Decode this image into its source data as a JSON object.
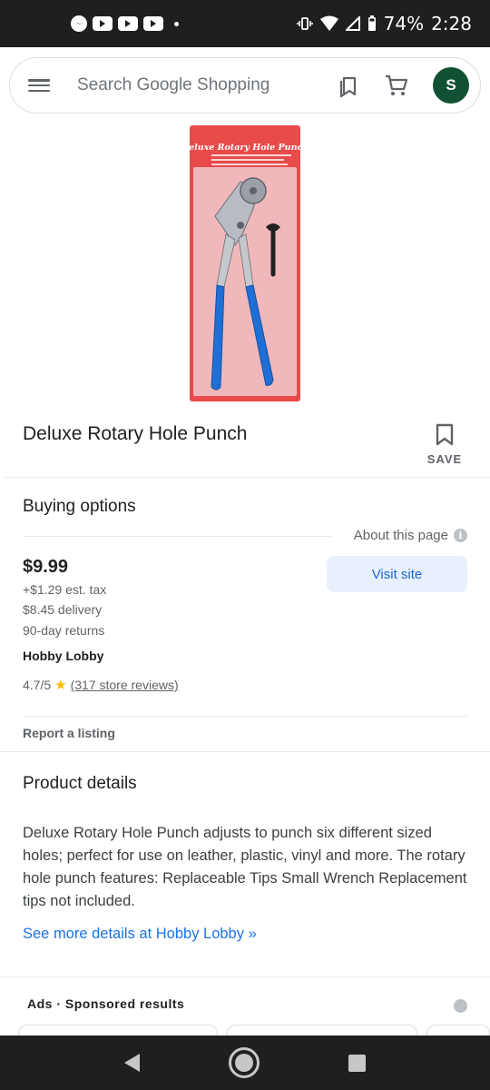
{
  "status_bar": {
    "battery": "74%",
    "time": "2:28"
  },
  "search": {
    "placeholder": "Search Google Shopping",
    "avatar_initial": "S"
  },
  "product": {
    "title": "Deluxe Rotary Hole Punch",
    "save_label": "SAVE",
    "package_text": "Deluxe Rotary Hole Punch"
  },
  "buying_options": {
    "heading": "Buying options",
    "about_page": "About this page",
    "price": "$9.99",
    "tax": "+$1.29 est. tax",
    "delivery": "$8.45 delivery",
    "returns": "90-day returns",
    "store": "Hobby Lobby",
    "rating": "4.7/5",
    "reviews": "(317 store reviews)",
    "visit_label": "Visit site",
    "report_label": "Report a listing"
  },
  "product_details": {
    "heading": "Product details",
    "description": "Deluxe Rotary Hole Punch adjusts to punch six different sized holes; perfect for use on leather, plastic, vinyl and more. The rotary hole punch features: Replaceable Tips Small Wrench Replacement tips not included.",
    "more_link": "See more details at Hobby Lobby »"
  },
  "ads": {
    "label": "Ads · Sponsored results"
  },
  "colors": {
    "accent": "#1a73e8",
    "visit_bg": "#e8f0fe",
    "avatar": "#0f5132",
    "star": "#fbbc04",
    "package_red": "#e94b4b",
    "handle_blue": "#1f6fd6"
  }
}
